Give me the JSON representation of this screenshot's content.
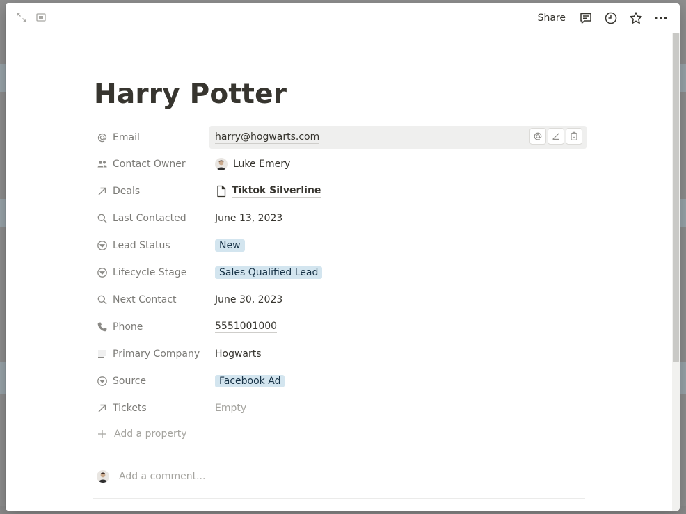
{
  "window": {
    "share_label": "Share",
    "icons": {
      "expand": "expand-icon",
      "peek": "side-peek-icon",
      "comments": "comment-icon",
      "history": "clock-icon",
      "favorite": "star-icon",
      "more": "more-icon"
    }
  },
  "page": {
    "title": "Harry Potter"
  },
  "properties": [
    {
      "label": "Email",
      "icon": "at-icon",
      "value": "harry@hogwarts.com"
    },
    {
      "label": "Contact Owner",
      "icon": "people-icon",
      "value": "Luke Emery"
    },
    {
      "label": "Deals",
      "icon": "relation-arrow-icon",
      "value": "Tiktok Silverline"
    },
    {
      "label": "Last Contacted",
      "icon": "search-icon",
      "value": "June 13, 2023"
    },
    {
      "label": "Lead Status",
      "icon": "select-icon",
      "value": "New"
    },
    {
      "label": "Lifecycle Stage",
      "icon": "select-icon",
      "value": "Sales Qualified Lead"
    },
    {
      "label": "Next Contact",
      "icon": "search-icon",
      "value": "June 30, 2023"
    },
    {
      "label": "Phone",
      "icon": "phone-icon",
      "value": "5551001000"
    },
    {
      "label": "Primary Company",
      "icon": "text-lines-icon",
      "value": "Hogwarts"
    },
    {
      "label": "Source",
      "icon": "select-icon",
      "value": "Facebook Ad"
    },
    {
      "label": "Tickets",
      "icon": "relation-arrow-icon",
      "value": "Empty"
    }
  ],
  "add_property_label": "Add a property",
  "comment": {
    "placeholder": "Add a comment..."
  },
  "colors": {
    "tag_background": "#d3e5ef",
    "tag_text": "#183347",
    "text": "#37352f",
    "muted": "#7c7b77"
  }
}
